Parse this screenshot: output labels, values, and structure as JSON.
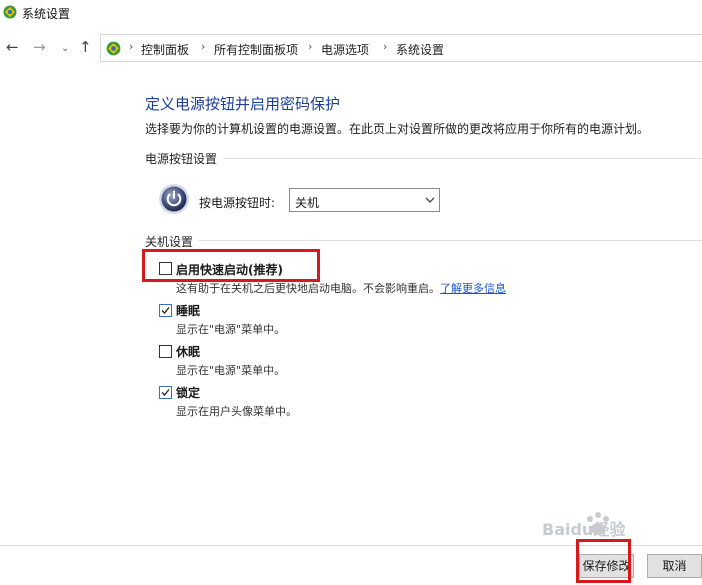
{
  "window": {
    "title": "系统设置"
  },
  "breadcrumb": [
    "控制面板",
    "所有控制面板项",
    "电源选项",
    "系统设置"
  ],
  "page": {
    "heading": "定义电源按钮并启用密码保护",
    "description": "选择要为你的计算机设置的电源设置。在此页上对设置所做的更改将应用于你所有的电源计划。"
  },
  "power_buttons": {
    "group_label": "电源按钮设置",
    "row_label": "按电源按钮时:",
    "selected": "关机"
  },
  "shutdown": {
    "group_label": "关机设置",
    "options": [
      {
        "label": "启用快速启动(推荐)",
        "checked": false,
        "description": "这有助于在关机之后更快地启动电脑。不会影响重启。",
        "link": "了解更多信息"
      },
      {
        "label": "睡眠",
        "checked": true,
        "description": "显示在\"电源\"菜单中。"
      },
      {
        "label": "休眠",
        "checked": false,
        "description": "显示在\"电源\"菜单中。"
      },
      {
        "label": "锁定",
        "checked": true,
        "description": "显示在用户头像菜单中。"
      }
    ]
  },
  "buttons": {
    "save": "保存修改",
    "cancel": "取消"
  },
  "colors": {
    "heading": "#1e3f96",
    "link": "#1a55c8",
    "highlight": "#d8191c",
    "check": "#3a6fc4"
  },
  "watermark": "Baidu经验"
}
